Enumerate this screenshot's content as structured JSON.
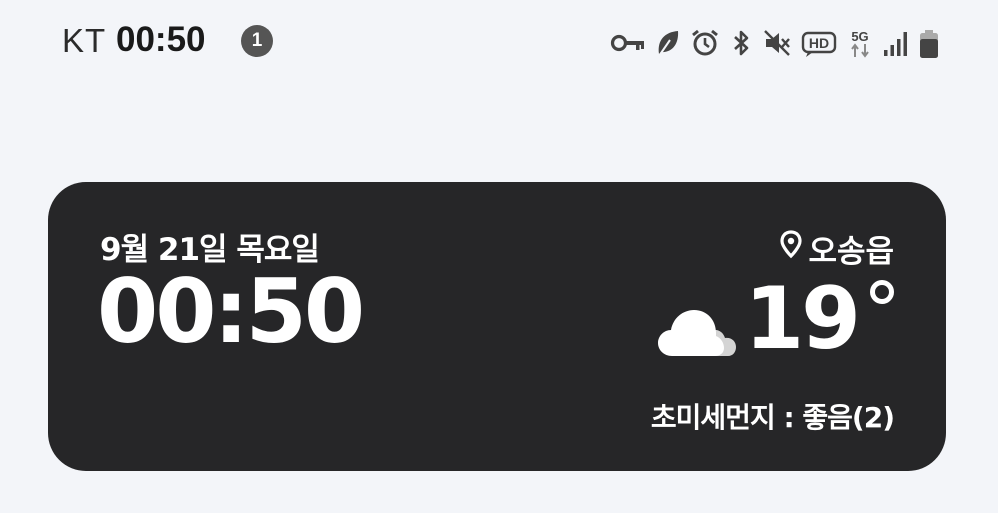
{
  "status_bar": {
    "carrier": "KT",
    "time": "00:50",
    "notification_count": "1",
    "icons": [
      "vpn-key-icon",
      "eco-leaf-icon",
      "alarm-icon",
      "bluetooth-icon",
      "mute-icon",
      "hd-voice-icon",
      "5g-icon",
      "signal-icon",
      "battery-icon"
    ],
    "network_label": "5G",
    "hd_label": "HD"
  },
  "widget": {
    "date": "9월 21일 목요일",
    "time": "00:50",
    "location": "오송읍",
    "temperature": "19",
    "weather_icon": "cloudy-icon",
    "fine_dust": "초미세먼지 : 좋음(2)",
    "colors": {
      "card_background": "#262628",
      "text": "#ffffff",
      "page_background": "#f3f5f9"
    }
  }
}
